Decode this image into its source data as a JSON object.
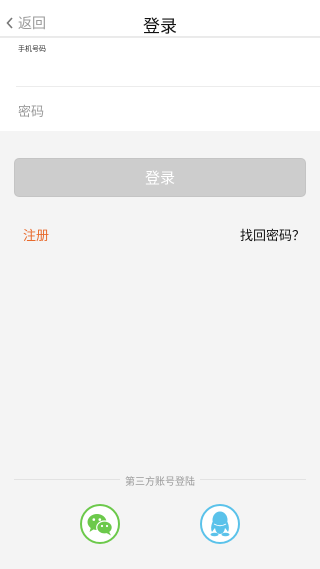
{
  "navbar": {
    "back_label": "返回",
    "title": "登录"
  },
  "form": {
    "phone_label": "手机号码",
    "phone_value": "",
    "password_placeholder": "密码",
    "password_value": ""
  },
  "login_button": "登录",
  "links": {
    "register": "注册",
    "forgot_password": "找回密码？"
  },
  "third_party": {
    "label": "第三方账号登陆",
    "providers": [
      {
        "icon": "wechat-icon",
        "color": "#6cc94b"
      },
      {
        "icon": "qq-icon",
        "color": "#5ac2ea"
      }
    ]
  },
  "colors": {
    "accent": "#e86a2c",
    "button_disabled": "#cdcdcd",
    "background": "#f4f4f4"
  }
}
